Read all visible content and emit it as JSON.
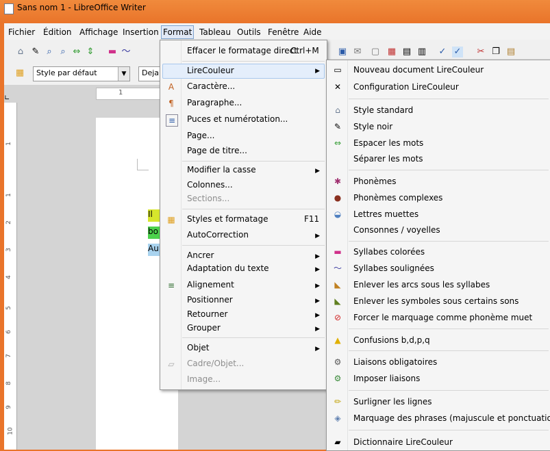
{
  "window": {
    "title": "Sans nom 1 - LibreOffice Writer"
  },
  "menubar": [
    "Fichier",
    "Édition",
    "Affichage",
    "Insertion",
    "Format",
    "Tableau",
    "Outils",
    "Fenêtre",
    "Aide"
  ],
  "toolbar2": {
    "paragraph_style": "Style par défaut",
    "font_name": "Deja"
  },
  "ruler": {
    "h_mark": "1",
    "v_marks": [
      "1",
      "1",
      "2",
      "3",
      "4",
      "5",
      "6",
      "7",
      "8",
      "9",
      "10"
    ]
  },
  "doc": {
    "line1": "Il",
    "line2": "bo",
    "line3": "Au"
  },
  "format_menu": {
    "clear": "Effacer le formatage direct",
    "clear_shortcut": "Ctrl+M",
    "items": [
      {
        "label": "LireCouleur",
        "submenu": true
      },
      {
        "label": "Caractère...",
        "submenu": false
      },
      {
        "label": "Paragraphe...",
        "submenu": false
      },
      {
        "label": "Puces et numérotation...",
        "submenu": false
      },
      {
        "label": "Page...",
        "submenu": false
      },
      {
        "label": "Page de titre...",
        "submenu": false
      },
      {
        "label": "Modifier la casse",
        "submenu": true
      },
      {
        "label": "Colonnes...",
        "submenu": false
      },
      {
        "label": "Sections...",
        "submenu": false,
        "disabled": true
      },
      {
        "label": "Styles et formatage",
        "shortcut": "F11"
      },
      {
        "label": "AutoCorrection",
        "submenu": true
      },
      {
        "label": "Ancrer",
        "submenu": true
      },
      {
        "label": "Adaptation du texte",
        "submenu": true
      },
      {
        "label": "Alignement",
        "submenu": true
      },
      {
        "label": "Positionner",
        "submenu": true
      },
      {
        "label": "Retourner",
        "submenu": true
      },
      {
        "label": "Grouper",
        "submenu": true
      },
      {
        "label": "Objet",
        "submenu": true
      },
      {
        "label": "Cadre/Objet...",
        "disabled": true
      },
      {
        "label": "Image...",
        "disabled": true
      }
    ]
  },
  "lirecouleur_menu": {
    "items": [
      "Nouveau document LireCouleur",
      "Configuration LireCouleur",
      "Style standard",
      "Style noir",
      "Espacer les mots",
      "Séparer les mots",
      "Phonèmes",
      "Phonèmes complexes",
      "Lettres muettes",
      "Consonnes / voyelles",
      "Syllabes colorées",
      "Syllabes soulignées",
      "Enlever les arcs sous les syllabes",
      "Enlever les symboles sous certains sons",
      "Forcer le marquage comme phonème muet",
      "Confusions b,d,p,q",
      "Liaisons obligatoires",
      "Imposer liaisons",
      "Surligner les lignes",
      "Marquage des phrases (majuscule et ponctuation)",
      "Dictionnaire LireCouleur"
    ]
  },
  "colors": {
    "titlebar": "#e9742a",
    "highlight_green": "#4cd24c",
    "highlight_yellow": "#d7e62c",
    "highlight_blue": "#a9d3ef"
  }
}
